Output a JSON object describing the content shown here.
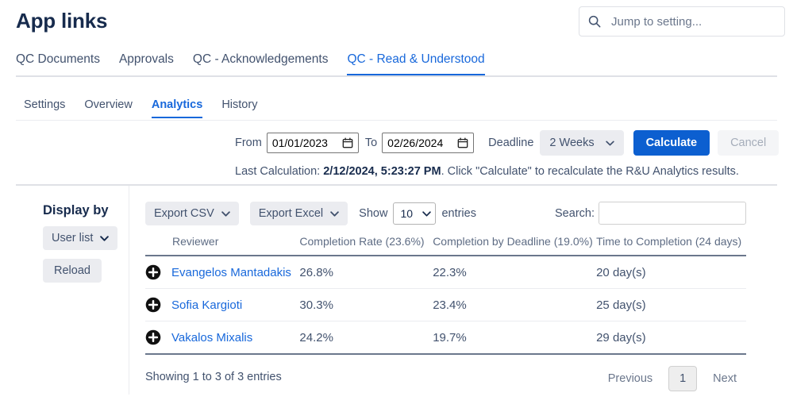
{
  "header": {
    "title": "App links",
    "search": {
      "placeholder": "Jump to setting...",
      "value": "",
      "icon": "search-icon"
    }
  },
  "main_tabs": [
    {
      "label": "QC Documents",
      "active": false
    },
    {
      "label": "Approvals",
      "active": false
    },
    {
      "label": "QC - Acknowledgements",
      "active": false
    },
    {
      "label": "QC - Read & Understood",
      "active": true
    }
  ],
  "sub_tabs": [
    {
      "label": "Settings",
      "active": false
    },
    {
      "label": "Overview",
      "active": false
    },
    {
      "label": "Analytics",
      "active": true
    },
    {
      "label": "History",
      "active": false
    }
  ],
  "toolbar": {
    "from_label": "From",
    "from_value": "01/01/2023",
    "to_label": "To",
    "to_value": "02/26/2024",
    "deadline_label": "Deadline",
    "deadline_value": "2 Weeks",
    "calculate_label": "Calculate",
    "cancel_label": "Cancel",
    "calendar_icon": "calendar-icon",
    "chevron_icon": "chevron-down-icon"
  },
  "status": {
    "prefix": "Last Calculation: ",
    "timestamp": "2/12/2024, 5:23:27 PM",
    "suffix": ". Click \"Calculate\" to recalculate the R&U Analytics results."
  },
  "sidebar": {
    "title": "Display by",
    "display_by_value": "User list",
    "reload_label": "Reload"
  },
  "table_controls": {
    "export_csv_label": "Export CSV",
    "export_excel_label": "Export Excel",
    "show_label": "Show",
    "entries_value": "10",
    "entries_label": "entries",
    "search_label": "Search:",
    "search_value": "",
    "search_placeholder": ""
  },
  "table": {
    "columns": [
      "Reviewer",
      "Completion Rate (23.6%)",
      "Completion by Deadline (19.0%)",
      "Time to Completion (24 days)"
    ],
    "rows": [
      {
        "reviewer": "Evangelos Mantadakis",
        "completion_rate": "26.8%",
        "completion_by_deadline": "22.3%",
        "time_to_completion": "20 day(s)"
      },
      {
        "reviewer": "Sofia Kargioti",
        "completion_rate": "30.3%",
        "completion_by_deadline": "23.4%",
        "time_to_completion": "25 day(s)"
      },
      {
        "reviewer": "Vakalos Mixalis",
        "completion_rate": "24.2%",
        "completion_by_deadline": "19.7%",
        "time_to_completion": "29 day(s)"
      }
    ]
  },
  "footer": {
    "showing": "Showing 1 to 3 of 3 entries",
    "previous_label": "Previous",
    "current_page": "1",
    "next_label": "Next"
  },
  "colors": {
    "accent_blue": "#1868db",
    "primary_button": "#0c5fd0",
    "text_dark": "#172b4d",
    "text_muted": "#42526e",
    "header_text": "#5e6c84",
    "chip_bg": "#ebecf0"
  }
}
